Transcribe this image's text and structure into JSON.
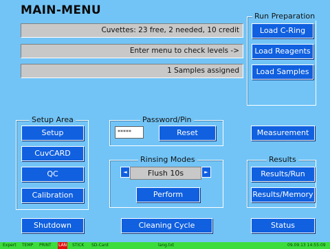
{
  "header": {
    "title": "MAIN-MENU"
  },
  "info": {
    "cuvettes": "Cuvettes: 23 free, 2 needed, 10 credit",
    "levels": "Enter menu to check levels ->",
    "samples": "1 Samples assigned"
  },
  "run_preparation": {
    "label": "Run Preparation",
    "load_cring": "Load C-Ring",
    "load_reagents": "Load Reagents",
    "load_samples": "Load Samples"
  },
  "setup_area": {
    "label": "Setup Area",
    "setup": "Setup",
    "cuvcard": "CuvCARD",
    "qc": "QC",
    "calibration": "Calibration"
  },
  "password": {
    "label": "Password/Pin",
    "value": "*****",
    "reset": "Reset"
  },
  "rinsing": {
    "label": "Rinsing Modes",
    "mode": "Flush  10s",
    "perform": "Perform",
    "left_arrow": "◄",
    "right_arrow": "►"
  },
  "measurement": "Measurement",
  "results": {
    "label": "Results",
    "run": "Results/Run",
    "memory": "Results/Memory"
  },
  "bottom": {
    "shutdown": "Shutdown",
    "cleaning": "Cleaning Cycle",
    "status": "Status"
  },
  "statusbar": {
    "expert": "Expert",
    "temp": "TEMP",
    "print": "PRINT",
    "lan": "LAN",
    "stick": "STICK",
    "sdcard": "SD-Card",
    "file": "lang.txt",
    "datetime": "09.09.13  14:55:09"
  },
  "colors": {
    "background": "#72c4f6",
    "button": "#1060e0",
    "statusbar": "#3cdc3c",
    "lan_alert": "#e01010"
  }
}
